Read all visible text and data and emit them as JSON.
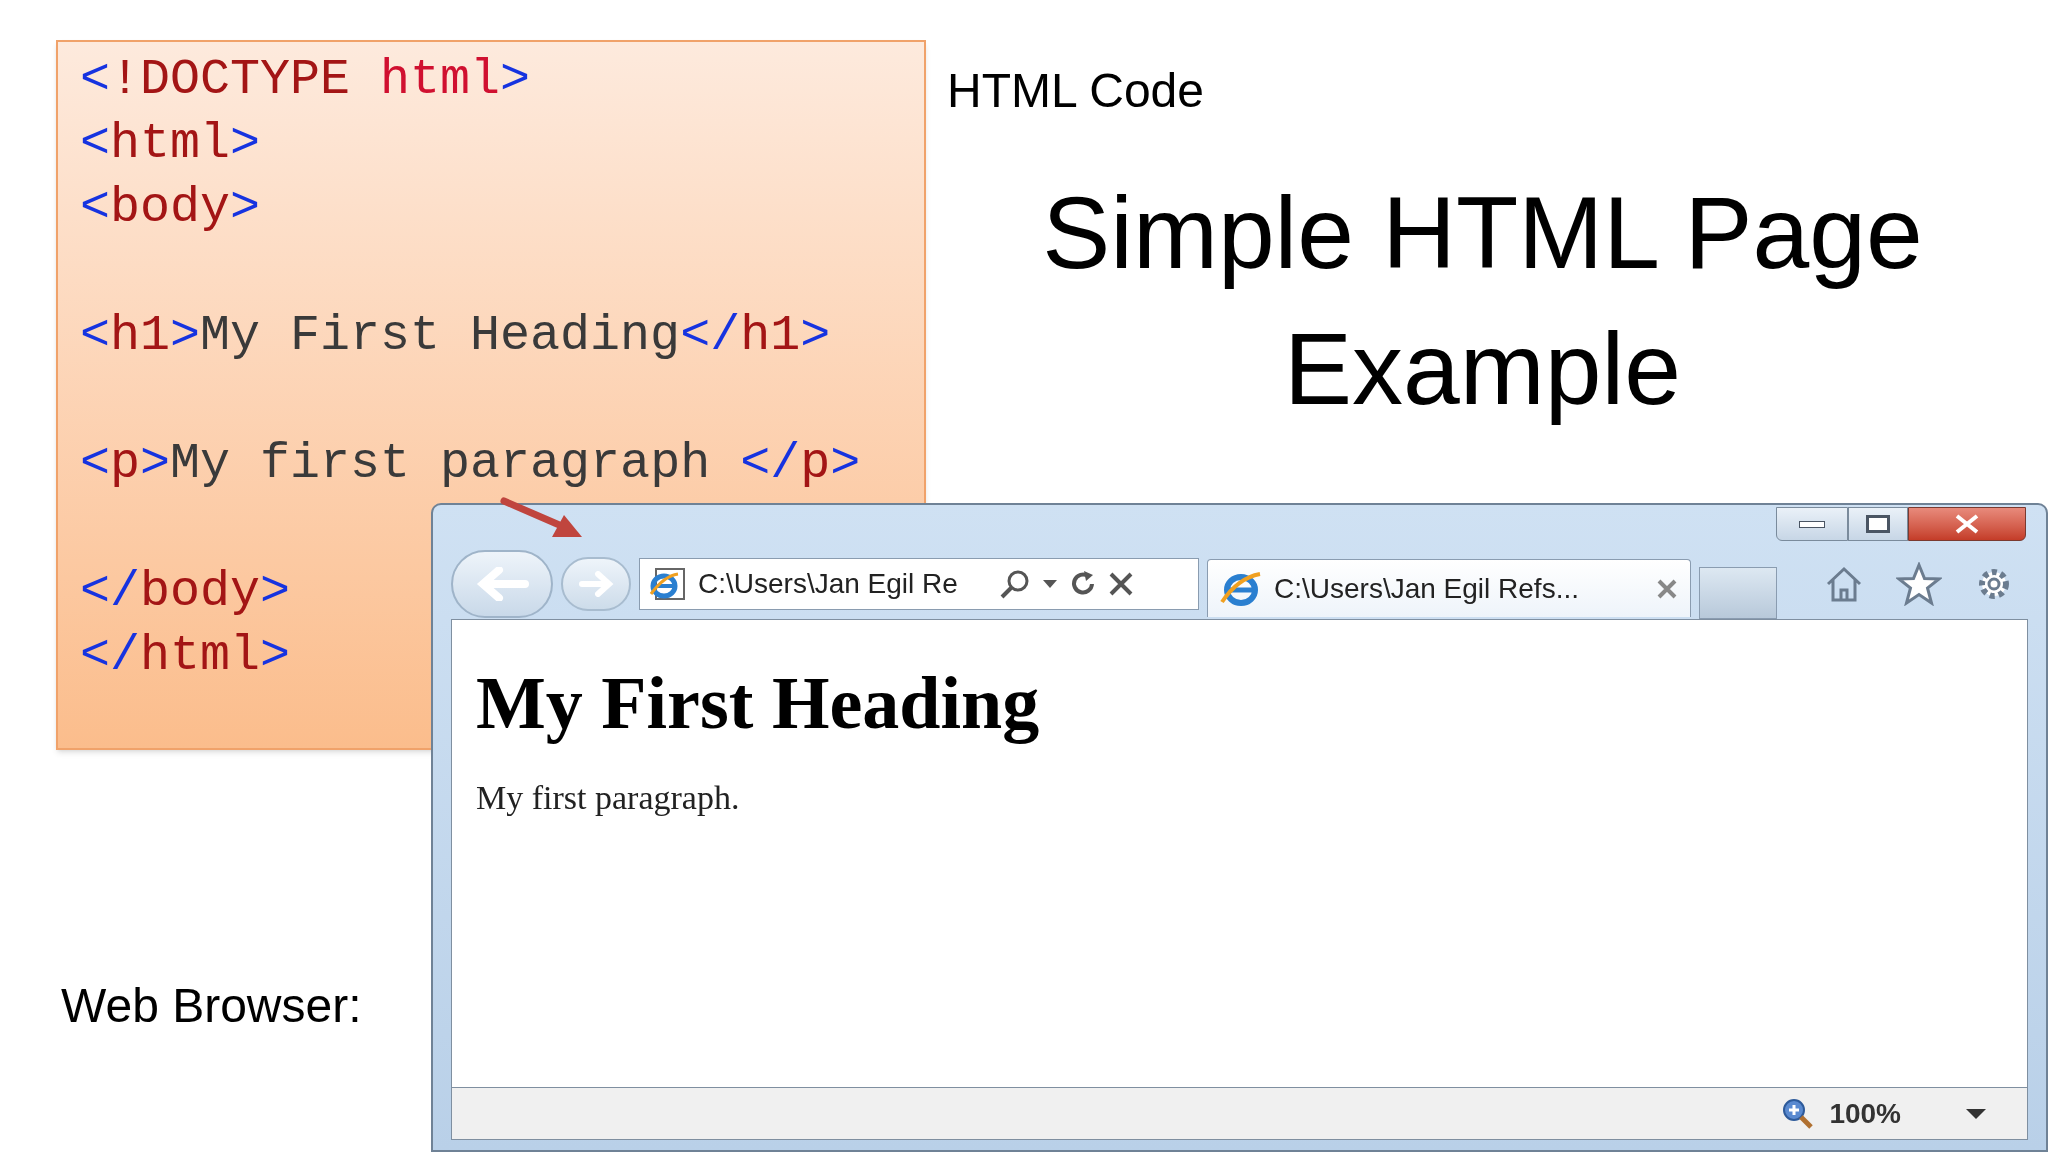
{
  "slide": {
    "code_caption": "HTML Code",
    "title": "Simple HTML Page Example",
    "browser_caption": "Web Browser:"
  },
  "code_lines": [
    {
      "kind": "code",
      "tokens": [
        {
          "kind": "bracket",
          "text": "<"
        },
        {
          "kind": "tag",
          "text": "!DOCTYPE "
        },
        {
          "kind": "attr",
          "text": "html"
        },
        {
          "kind": "bracket",
          "text": ">"
        }
      ]
    },
    {
      "kind": "code",
      "tokens": [
        {
          "kind": "bracket",
          "text": "<"
        },
        {
          "kind": "tag",
          "text": "html"
        },
        {
          "kind": "bracket",
          "text": ">"
        }
      ]
    },
    {
      "kind": "code",
      "tokens": [
        {
          "kind": "bracket",
          "text": "<"
        },
        {
          "kind": "tag",
          "text": "body"
        },
        {
          "kind": "bracket",
          "text": ">"
        }
      ]
    },
    {
      "kind": "blank"
    },
    {
      "kind": "code",
      "tokens": [
        {
          "kind": "bracket",
          "text": "<"
        },
        {
          "kind": "tag",
          "text": "h1"
        },
        {
          "kind": "bracket",
          "text": ">"
        },
        {
          "kind": "text",
          "text": "My First Heading"
        },
        {
          "kind": "bracket",
          "text": "</"
        },
        {
          "kind": "tag",
          "text": "h1"
        },
        {
          "kind": "bracket",
          "text": ">"
        }
      ]
    },
    {
      "kind": "blank"
    },
    {
      "kind": "code",
      "tokens": [
        {
          "kind": "bracket",
          "text": "<"
        },
        {
          "kind": "tag",
          "text": "p"
        },
        {
          "kind": "bracket",
          "text": ">"
        },
        {
          "kind": "text",
          "text": "My first paragraph "
        },
        {
          "kind": "bracket",
          "text": "</"
        },
        {
          "kind": "tag",
          "text": "p"
        },
        {
          "kind": "bracket",
          "text": ">"
        }
      ]
    },
    {
      "kind": "blank"
    },
    {
      "kind": "code",
      "tokens": [
        {
          "kind": "bracket",
          "text": "</"
        },
        {
          "kind": "tag",
          "text": "body"
        },
        {
          "kind": "bracket",
          "text": ">"
        }
      ]
    },
    {
      "kind": "code",
      "tokens": [
        {
          "kind": "bracket",
          "text": "</"
        },
        {
          "kind": "tag",
          "text": "html"
        },
        {
          "kind": "bracket",
          "text": ">"
        }
      ]
    }
  ],
  "browser": {
    "address": "C:\\Users\\Jan Egil Re",
    "tabs": [
      {
        "title": "C:\\Users\\Jan Egil Refs...",
        "selected": true
      }
    ],
    "page_heading": "My First Heading",
    "page_paragraph": "My first paragraph.",
    "zoom": "100%"
  }
}
